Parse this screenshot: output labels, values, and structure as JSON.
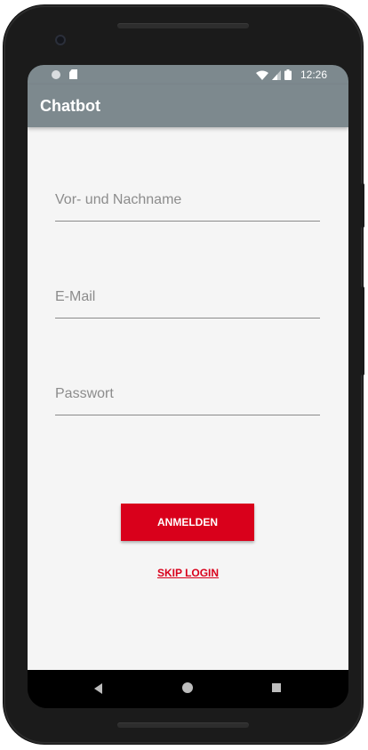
{
  "status_bar": {
    "time": "12:26",
    "icons": [
      "notification-dot-icon",
      "sd-card-icon",
      "wifi-icon",
      "signal-icon",
      "battery-icon"
    ]
  },
  "app_bar": {
    "title": "Chatbot",
    "color": "#7d898e"
  },
  "form": {
    "name_placeholder": "Vor- und Nachname",
    "email_placeholder": "E-Mail",
    "password_placeholder": "Passwort",
    "name_value": "",
    "email_value": "",
    "password_value": ""
  },
  "actions": {
    "login_label": "ANMELDEN",
    "skip_label": "SKIP LOGIN",
    "accent_color": "#d9001b"
  },
  "nav_bar": {
    "icons": [
      "back-icon",
      "home-icon",
      "recents-icon"
    ]
  }
}
